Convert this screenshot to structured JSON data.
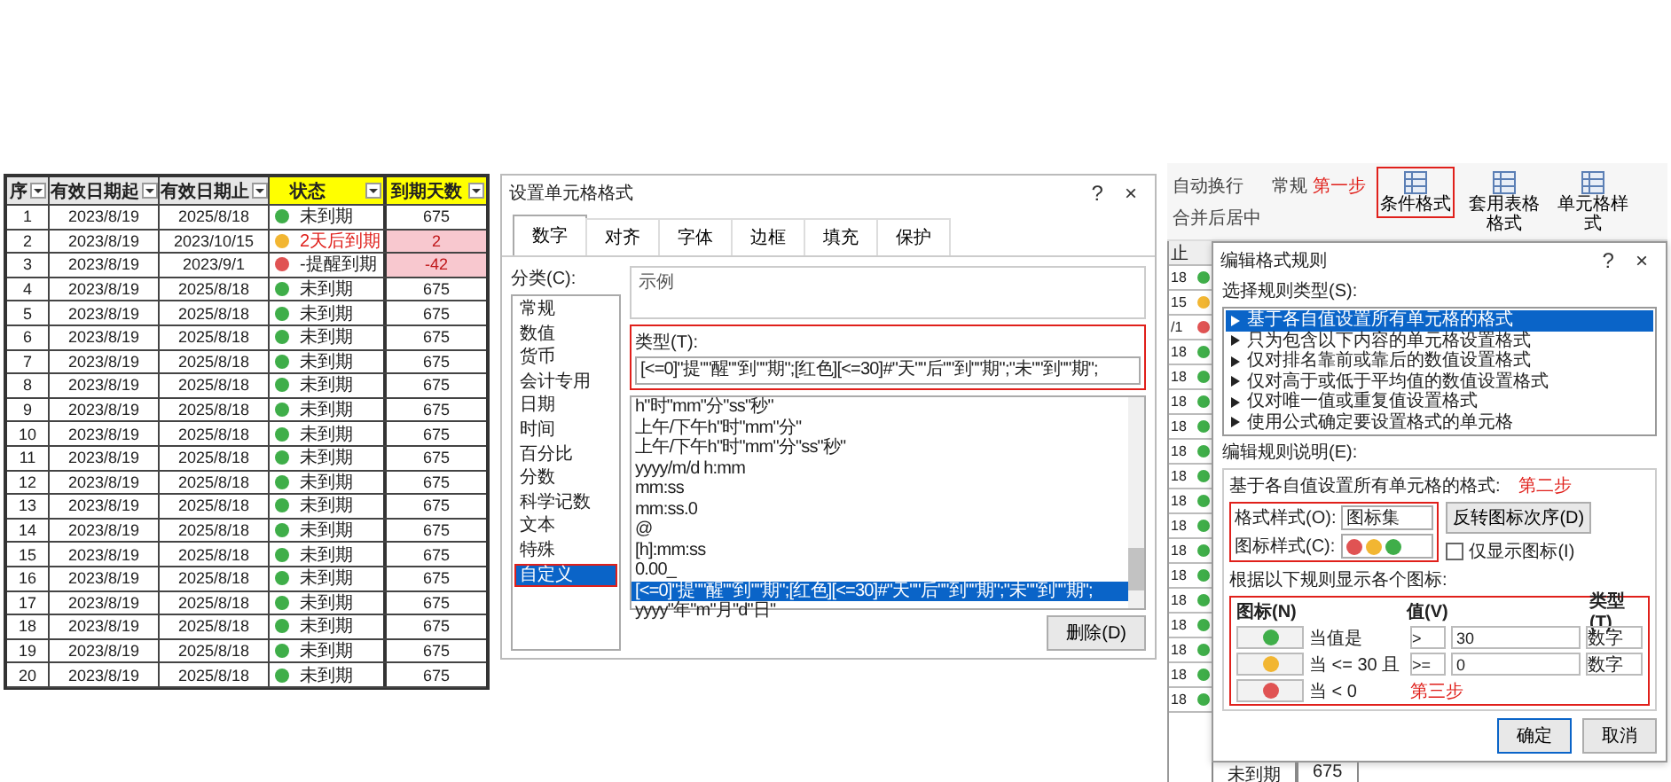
{
  "sheet": {
    "columns": [
      {
        "label": "序",
        "filter": true,
        "highlight": false
      },
      {
        "label": "有效日期起",
        "filter": true,
        "highlight": false
      },
      {
        "label": "有效日期止",
        "filter": true,
        "highlight": false
      },
      {
        "label": "状态",
        "filter": true,
        "highlight": true
      },
      {
        "label": "到期天数",
        "filter": true,
        "highlight": true
      }
    ],
    "rows": [
      {
        "no": "1",
        "start": "2023/8/19",
        "end": "2025/8/18",
        "color": "#3fae49",
        "status": "未到期",
        "alert": false,
        "days": "675",
        "warn": false
      },
      {
        "no": "2",
        "start": "2023/8/19",
        "end": "2023/10/15",
        "color": "#f2b632",
        "status": "2天后到期",
        "alert": true,
        "days": "2",
        "warn": true
      },
      {
        "no": "3",
        "start": "2023/8/19",
        "end": "2023/9/1",
        "color": "#e05353",
        "status": "-提醒到期",
        "alert": false,
        "days": "-42",
        "warn": true
      },
      {
        "no": "4",
        "start": "2023/8/19",
        "end": "2025/8/18",
        "color": "#3fae49",
        "status": "未到期",
        "alert": false,
        "days": "675",
        "warn": false
      },
      {
        "no": "5",
        "start": "2023/8/19",
        "end": "2025/8/18",
        "color": "#3fae49",
        "status": "未到期",
        "alert": false,
        "days": "675",
        "warn": false
      },
      {
        "no": "6",
        "start": "2023/8/19",
        "end": "2025/8/18",
        "color": "#3fae49",
        "status": "未到期",
        "alert": false,
        "days": "675",
        "warn": false
      },
      {
        "no": "7",
        "start": "2023/8/19",
        "end": "2025/8/18",
        "color": "#3fae49",
        "status": "未到期",
        "alert": false,
        "days": "675",
        "warn": false
      },
      {
        "no": "8",
        "start": "2023/8/19",
        "end": "2025/8/18",
        "color": "#3fae49",
        "status": "未到期",
        "alert": false,
        "days": "675",
        "warn": false
      },
      {
        "no": "9",
        "start": "2023/8/19",
        "end": "2025/8/18",
        "color": "#3fae49",
        "status": "未到期",
        "alert": false,
        "days": "675",
        "warn": false
      },
      {
        "no": "10",
        "start": "2023/8/19",
        "end": "2025/8/18",
        "color": "#3fae49",
        "status": "未到期",
        "alert": false,
        "days": "675",
        "warn": false
      },
      {
        "no": "11",
        "start": "2023/8/19",
        "end": "2025/8/18",
        "color": "#3fae49",
        "status": "未到期",
        "alert": false,
        "days": "675",
        "warn": false
      },
      {
        "no": "12",
        "start": "2023/8/19",
        "end": "2025/8/18",
        "color": "#3fae49",
        "status": "未到期",
        "alert": false,
        "days": "675",
        "warn": false
      },
      {
        "no": "13",
        "start": "2023/8/19",
        "end": "2025/8/18",
        "color": "#3fae49",
        "status": "未到期",
        "alert": false,
        "days": "675",
        "warn": false
      },
      {
        "no": "14",
        "start": "2023/8/19",
        "end": "2025/8/18",
        "color": "#3fae49",
        "status": "未到期",
        "alert": false,
        "days": "675",
        "warn": false
      },
      {
        "no": "15",
        "start": "2023/8/19",
        "end": "2025/8/18",
        "color": "#3fae49",
        "status": "未到期",
        "alert": false,
        "days": "675",
        "warn": false
      },
      {
        "no": "16",
        "start": "2023/8/19",
        "end": "2025/8/18",
        "color": "#3fae49",
        "status": "未到期",
        "alert": false,
        "days": "675",
        "warn": false
      },
      {
        "no": "17",
        "start": "2023/8/19",
        "end": "2025/8/18",
        "color": "#3fae49",
        "status": "未到期",
        "alert": false,
        "days": "675",
        "warn": false
      },
      {
        "no": "18",
        "start": "2023/8/19",
        "end": "2025/8/18",
        "color": "#3fae49",
        "status": "未到期",
        "alert": false,
        "days": "675",
        "warn": false
      },
      {
        "no": "19",
        "start": "2023/8/19",
        "end": "2025/8/18",
        "color": "#3fae49",
        "status": "未到期",
        "alert": false,
        "days": "675",
        "warn": false
      },
      {
        "no": "20",
        "start": "2023/8/19",
        "end": "2025/8/18",
        "color": "#3fae49",
        "status": "未到期",
        "alert": false,
        "days": "675",
        "warn": false
      }
    ]
  },
  "format_dialog": {
    "title": "设置单元格格式",
    "help": "?",
    "close": "×",
    "tabs": [
      {
        "label": "数字",
        "selected": true
      },
      {
        "label": "对齐",
        "selected": false
      },
      {
        "label": "字体",
        "selected": false
      },
      {
        "label": "边框",
        "selected": false
      },
      {
        "label": "填充",
        "selected": false
      },
      {
        "label": "保护",
        "selected": false
      }
    ],
    "category_label": "分类(C):",
    "categories": [
      {
        "label": "常规",
        "selected": false,
        "annotated": false
      },
      {
        "label": "数值",
        "selected": false,
        "annotated": false
      },
      {
        "label": "货币",
        "selected": false,
        "annotated": false
      },
      {
        "label": "会计专用",
        "selected": false,
        "annotated": false
      },
      {
        "label": "日期",
        "selected": false,
        "annotated": false
      },
      {
        "label": "时间",
        "selected": false,
        "annotated": false
      },
      {
        "label": "百分比",
        "selected": false,
        "annotated": false
      },
      {
        "label": "分数",
        "selected": false,
        "annotated": false
      },
      {
        "label": "科学记数",
        "selected": false,
        "annotated": false
      },
      {
        "label": "文本",
        "selected": false,
        "annotated": false
      },
      {
        "label": "特殊",
        "selected": false,
        "annotated": false
      },
      {
        "label": "自定义",
        "selected": true,
        "annotated": true
      }
    ],
    "sample_label": "示例",
    "type_label": "类型(T):",
    "type_value": "[<=0]\"提\"\"醒\"\"到\"\"期\";[红色][<=30]#\"天\"\"后\"\"到\"\"期\";\"未\"\"到\"\"期\";",
    "type_annotated": true,
    "formats": [
      {
        "label": "h\"时\"mm\"分\"ss\"秒\"",
        "selected": false
      },
      {
        "label": "上午/下午h\"时\"mm\"分\"",
        "selected": false
      },
      {
        "label": "上午/下午h\"时\"mm\"分\"ss\"秒\"",
        "selected": false
      },
      {
        "label": "yyyy/m/d h:mm",
        "selected": false
      },
      {
        "label": "mm:ss",
        "selected": false
      },
      {
        "label": "mm:ss.0",
        "selected": false
      },
      {
        "label": "@",
        "selected": false
      },
      {
        "label": "[h]:mm:ss",
        "selected": false
      },
      {
        "label": "0.00_",
        "selected": false
      },
      {
        "label": "[<=0]\"提\"\"醒\"\"到\"\"期\";[红色][<=30]#\"天\"\"后\"\"到\"\"期\";\"未\"\"到\"\"期\";",
        "selected": true
      },
      {
        "label": "yyyy\"年\"m\"月\"d\"日\"",
        "selected": false
      }
    ],
    "delete_button": "删除(D)"
  },
  "ribbon": {
    "wrap": "自动换行",
    "merge": "合并后居中",
    "number_format": "常规",
    "step": "第一步",
    "buttons": [
      {
        "label": "条件格式",
        "annotated": true
      },
      {
        "label": "套用表格格式",
        "annotated": false
      },
      {
        "label": "单元格样式",
        "annotated": false
      }
    ]
  },
  "back_sheet": {
    "header": "止",
    "rows": [
      {
        "text": "18",
        "color": "#3fae49"
      },
      {
        "text": "15",
        "color": "#f2b632"
      },
      {
        "text": "/1",
        "color": "#e05353"
      },
      {
        "text": "18",
        "color": "#3fae49"
      },
      {
        "text": "18",
        "color": "#3fae49"
      },
      {
        "text": "18",
        "color": "#3fae49"
      },
      {
        "text": "18",
        "color": "#3fae49"
      },
      {
        "text": "18",
        "color": "#3fae49"
      },
      {
        "text": "18",
        "color": "#3fae49"
      },
      {
        "text": "18",
        "color": "#3fae49"
      },
      {
        "text": "18",
        "color": "#3fae49"
      },
      {
        "text": "18",
        "color": "#3fae49"
      },
      {
        "text": "18",
        "color": "#3fae49"
      },
      {
        "text": "18",
        "color": "#3fae49"
      },
      {
        "text": "18",
        "color": "#3fae49"
      },
      {
        "text": "18",
        "color": "#3fae49"
      },
      {
        "text": "18",
        "color": "#3fae49"
      },
      {
        "text": "18",
        "color": "#3fae49"
      }
    ],
    "footer_status": "未到期",
    "footer_days": "675"
  },
  "rule_dialog": {
    "title": "编辑格式规则",
    "help": "?",
    "close": "×",
    "type_label": "选择规则类型(S):",
    "rule_types": [
      {
        "label": "基于各自值设置所有单元格的格式",
        "selected": true
      },
      {
        "label": "只为包含以下内容的单元格设置格式",
        "selected": false
      },
      {
        "label": "仅对排名靠前或靠后的数值设置格式",
        "selected": false
      },
      {
        "label": "仅对高于或低于平均值的数值设置格式",
        "selected": false
      },
      {
        "label": "仅对唯一值或重复值设置格式",
        "selected": false
      },
      {
        "label": "使用公式确定要设置格式的单元格",
        "selected": false
      }
    ],
    "desc_label": "编辑规则说明(E):",
    "desc_heading": "基于各自值设置所有单元格的格式:",
    "step2": "第二步",
    "format_style_label": "格式样式(O):",
    "format_style": "图标集",
    "reverse_button": "反转图标次序(D)",
    "icon_style_label": "图标样式(C):",
    "icon_style": [
      {
        "color": "#e05353"
      },
      {
        "color": "#f2b632"
      },
      {
        "color": "#3fae49"
      }
    ],
    "show_icon_only": {
      "label": "仅显示图标(I)",
      "checked": false
    },
    "rules_label": "根据以下规则显示各个图标:",
    "col_icon": "图标(N)",
    "col_value": "值(V)",
    "col_type": "类型(T)",
    "icon_rules": [
      {
        "color": "#3fae49",
        "condition": "当值是",
        "operator": ">",
        "value": "30",
        "type": "数字"
      },
      {
        "color": "#f2b632",
        "condition": "当 <= 30 且",
        "operator": ">=",
        "value": "0",
        "type": "数字"
      },
      {
        "color": "#e05353",
        "condition": "当 < 0"
      }
    ],
    "step3": "第三步",
    "ok": "确定",
    "cancel": "取消"
  }
}
